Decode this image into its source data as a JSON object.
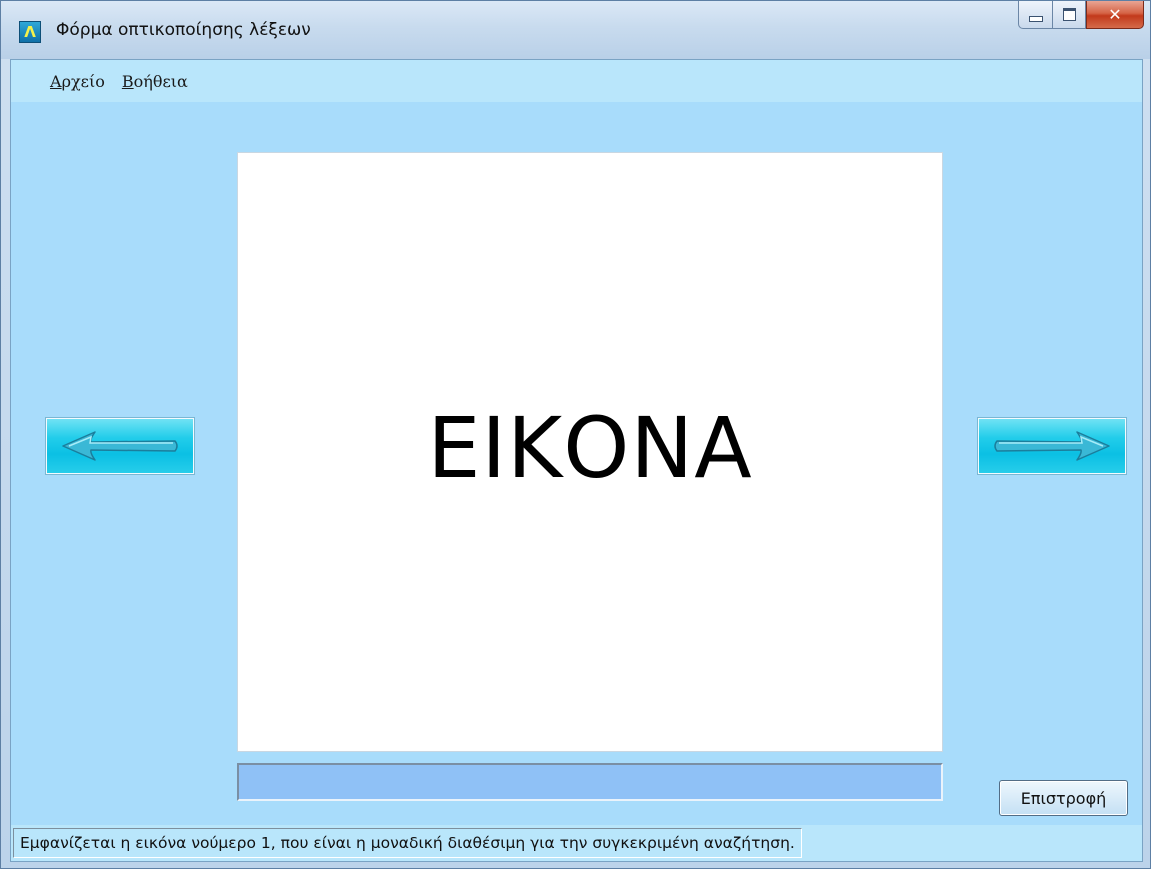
{
  "window": {
    "title": "Φόρμα οπτικοποίησης λέξεων",
    "app_icon_glyph": "Λ",
    "close_glyph": "✕"
  },
  "menu": {
    "items": [
      {
        "accel": "Α",
        "rest": "ρχείο"
      },
      {
        "accel": "Β",
        "rest": "οήθεια"
      }
    ]
  },
  "picture": {
    "text": "ΕΙΚΟΝΑ"
  },
  "navigation": {
    "prev_icon": "left-arrow-icon",
    "next_icon": "right-arrow-icon"
  },
  "word_field": {
    "value": "",
    "placeholder": ""
  },
  "buttons": {
    "return_label": "Επιστροφή"
  },
  "status": {
    "text": "Εμφανίζεται η εικόνα νούμερο 1, που είναι η μοναδική διαθέσιμη για την συγκεκριμένη αναζήτηση."
  },
  "colors": {
    "client_bg": "#a8dcfb",
    "nav_button": "#0bc0e4",
    "word_field_bg": "#8fc1f6"
  }
}
